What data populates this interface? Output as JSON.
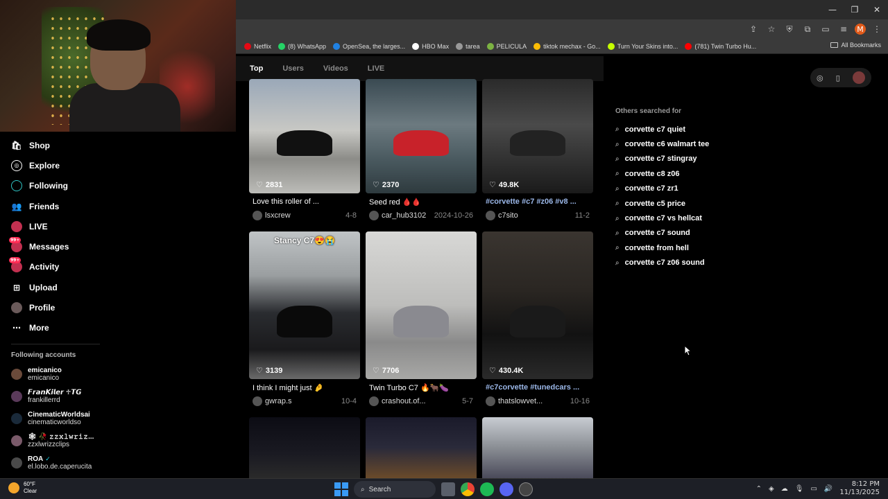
{
  "browser": {
    "bookmarks": [
      {
        "label": "Netflix",
        "color": "#e50914"
      },
      {
        "label": "(8) WhatsApp",
        "color": "#25d366"
      },
      {
        "label": "OpenSea, the larges...",
        "color": "#2081e2"
      },
      {
        "label": "HBO Max",
        "color": "#ffffff"
      },
      {
        "label": "tarea",
        "color": "#999999"
      },
      {
        "label": "PELICULA",
        "color": "#7cb342"
      },
      {
        "label": "tiktok mechax - Go...",
        "color": "#fbbc04"
      },
      {
        "label": "Turn Your Skins into...",
        "color": "#c6ff00"
      },
      {
        "label": "(781) Twin Turbo Hu...",
        "color": "#ff0000"
      }
    ],
    "all_bookmarks": "All Bookmarks",
    "profile_initial": "M"
  },
  "sidebar": {
    "nav": [
      {
        "label": "Shop",
        "icon": "shop-icon"
      },
      {
        "label": "Explore",
        "icon": "explore-icon"
      },
      {
        "label": "Following",
        "icon": "following-icon"
      },
      {
        "label": "Friends",
        "icon": "friends-icon"
      },
      {
        "label": "LIVE",
        "icon": "live-icon"
      },
      {
        "label": "Messages",
        "icon": "messages-icon",
        "badge": "99+"
      },
      {
        "label": "Activity",
        "icon": "activity-icon",
        "badge": "99+"
      },
      {
        "label": "Upload",
        "icon": "upload-icon"
      },
      {
        "label": "Profile",
        "icon": "profile-icon"
      },
      {
        "label": "More",
        "icon": "more-icon"
      }
    ],
    "following_title": "Following accounts",
    "accounts": [
      {
        "name": "emicanico",
        "handle": "emicanico"
      },
      {
        "name": "𝙁𝙧𝙖𝙣𝙆𝙞𝙡𝙚𝙧 ♱𝙏𝙂",
        "handle": "frankillerrd"
      },
      {
        "name": "CinematicWorldsai",
        "handle": "cinematicworldso"
      },
      {
        "name": "🕸 🥀 𝚣𝚣𝚡𝚕𝚠𝚛𝚒𝚣...",
        "handle": "zzxlwrizzclips"
      },
      {
        "name": "ROA",
        "handle": "el.lobo.de.caperucita",
        "verified": true
      }
    ]
  },
  "tabs": [
    {
      "label": "Top",
      "active": true
    },
    {
      "label": "Users",
      "active": false
    },
    {
      "label": "Videos",
      "active": false
    },
    {
      "label": "LIVE",
      "active": false
    }
  ],
  "videos": [
    {
      "likes": "2831",
      "caption": "Love this roller of ...",
      "author": "lsxcrew",
      "date": "4-8",
      "tag": false
    },
    {
      "likes": "2370",
      "caption": "Seed red 🩸🩸",
      "author": "car_hub3102",
      "date": "2024-10-26",
      "tag": false
    },
    {
      "likes": "49.8K",
      "caption": "#corvette #c7 #z06 #v8 ...",
      "author": "c7sito",
      "date": "11-2",
      "tag": true
    },
    {
      "likes": "3139",
      "caption": "I think I might just 🤌",
      "author": "gwrap.s",
      "date": "10-4",
      "tag": false,
      "overlay": "Stancy C7😍😭"
    },
    {
      "likes": "7706",
      "caption": "Twin Turbo C7 🔥🐂🍆",
      "author": "crashout.of...",
      "date": "5-7",
      "tag": false
    },
    {
      "likes": "430.4K",
      "caption": "#c7corvette #tunedcars ...",
      "author": "thatslowvet...",
      "date": "10-16",
      "tag": true
    }
  ],
  "right_panel": {
    "others_title": "Others searched for",
    "suggestions": [
      "corvette c7 quiet",
      "corvette c6 walmart tee",
      "corvette c7 stingray",
      "corvette c8 z06",
      "corvette c7 zr1",
      "corvette c5 price",
      "corvette c7 vs hellcat",
      "corvette c7 sound",
      "corvette from hell",
      "corvette c7 z06 sound"
    ]
  },
  "taskbar": {
    "temp": "60°F",
    "condition": "Clear",
    "search": "Search",
    "time": "8:12 PM",
    "date": "11/13/2025"
  }
}
